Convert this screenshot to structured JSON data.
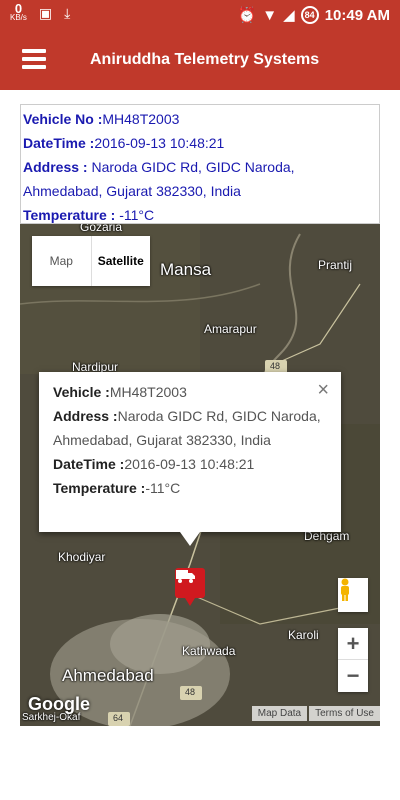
{
  "status_bar": {
    "speed_value": "0",
    "speed_unit": "KB/s",
    "battery_level": "84",
    "time": "10:49 AM"
  },
  "app_bar": {
    "title": "Aniruddha Telemetry Systems"
  },
  "info_panel": {
    "vehicle_label": "Vehicle No :",
    "vehicle_value": "MH48T2003",
    "datetime_label": "DateTime :",
    "datetime_value": "2016-09-13 10:48:21",
    "address_label": "Address :",
    "address_value": " Naroda GIDC Rd, GIDC Naroda, Ahmedabad, Gujarat 382330, India",
    "temperature_label": "Temperature :",
    "temperature_value": " -11°C"
  },
  "map": {
    "map_type_map": "Map",
    "map_type_satellite": "Satellite",
    "places": {
      "gozaria": "Gozaria",
      "mansa": "Mansa",
      "prantij": "Prantij",
      "amarapur": "Amarapur",
      "nardipur": "Nardipur",
      "dehgam": "Dehgam",
      "khodiyar": "Khodiyar",
      "kathwada": "Kathwada",
      "karoli": "Karoli",
      "ahmedabad": "Ahmedabad",
      "sarkhej": "Sarkhej-Okaf",
      "highway_48_a": "48",
      "highway_48_b": "48",
      "highway_64": "64"
    },
    "info_window": {
      "vehicle_label": "Vehicle :",
      "vehicle_value": "MH48T2003",
      "address_label": "Address :",
      "address_value": "Naroda GIDC Rd, GIDC Naroda, Ahmedabad, Gujarat 382330, India",
      "datetime_label": "DateTime :",
      "datetime_value": "2016-09-13 10:48:21",
      "temperature_label": "Temperature :",
      "temperature_value": "-11°C",
      "close_symbol": "×"
    },
    "zoom_in": "+",
    "zoom_out": "−",
    "google_logo": "Google",
    "attribution_map_data": "Map Data",
    "attribution_terms": "Terms of Use"
  },
  "colors": {
    "app_bar": "#c0392b",
    "info_text": "#1a1ab0",
    "marker": "#d0191f"
  }
}
